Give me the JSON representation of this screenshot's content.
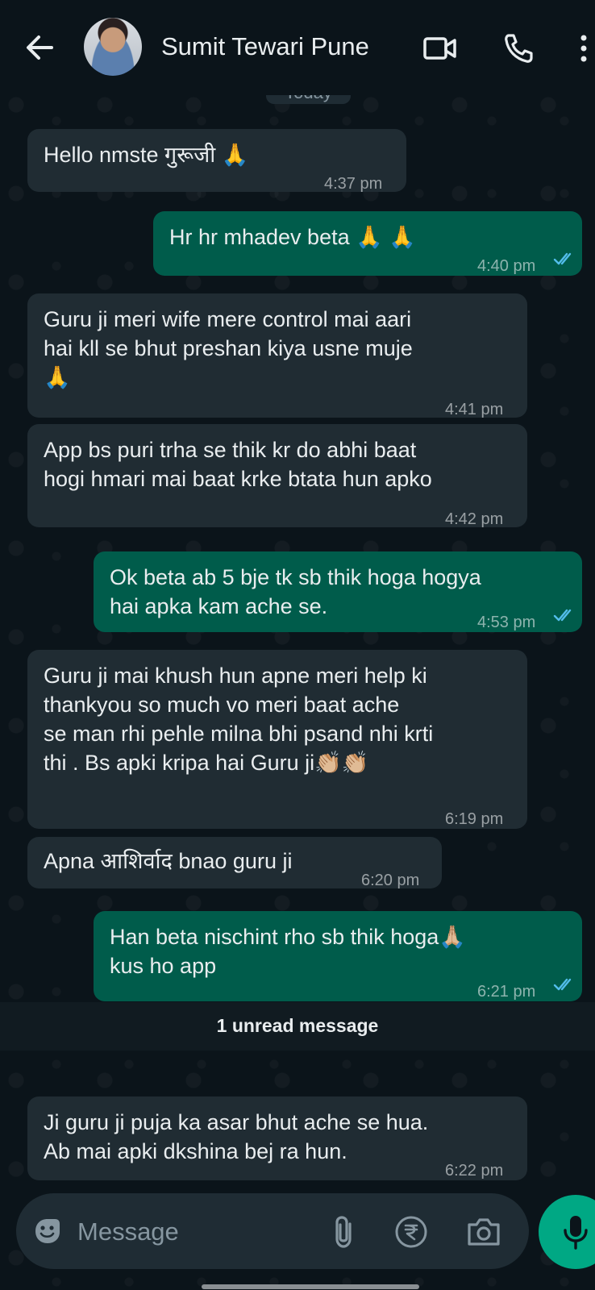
{
  "header": {
    "contact_name": "Sumit Tewari Pune",
    "icons": [
      "back-arrow-icon",
      "video-call-icon",
      "phone-call-icon",
      "more-vert-icon"
    ]
  },
  "date_chip": "Today",
  "messages": [
    {
      "direction": "incoming",
      "text": "Hello nmste  गुरूजी 🙏",
      "time": "4:37 pm"
    },
    {
      "direction": "outgoing",
      "text": "Hr hr mhadev beta 🙏 🙏",
      "time": "4:40 pm",
      "status": "read"
    },
    {
      "direction": "incoming",
      "text": "Guru ji meri wife mere control  mai aari\nhai kll se bhut preshan kiya usne muje\n🙏",
      "time": "4:41 pm"
    },
    {
      "direction": "incoming",
      "text": "App bs puri trha se thik kr do abhi baat\nhogi hmari mai baat krke btata hun apko",
      "time": "4:42 pm"
    },
    {
      "direction": "outgoing",
      "text": "Ok beta ab 5 bje tk sb thik hoga hogya\nhai apka kam ache se.",
      "time": "4:53 pm",
      "status": "read"
    },
    {
      "direction": "incoming",
      "text": "Guru ji mai khush hun apne meri help ki\nthankyou  so much vo meri baat ache\nse man rhi pehle milna bhi psand nhi krti\nthi . Bs apki kripa hai Guru ji👏🏼👏🏼",
      "time": "6:19 pm"
    },
    {
      "direction": "incoming",
      "text": "Apna आशिर्वाद bnao guru ji",
      "time": "6:20 pm"
    },
    {
      "direction": "outgoing",
      "text": "Han beta nischint rho sb thik hoga🙏🏼\nkus ho app",
      "time": "6:21 pm",
      "status": "read"
    },
    {
      "direction": "incoming",
      "text": "Ji guru ji puja ka asar bhut ache se hua.\nAb mai apki dkshina bej ra hun.",
      "time": "6:22 pm"
    }
  ],
  "unread_banner": "1 unread message",
  "composer": {
    "placeholder": "Message",
    "icons": [
      "emoji-sticker-icon",
      "attach-icon",
      "rupee-payment-icon",
      "camera-icon",
      "mic-icon"
    ]
  },
  "colors": {
    "background": "#0b141a",
    "incoming_bubble": "#202c33",
    "outgoing_bubble": "#005c4b",
    "read_ticks": "#53bdeb",
    "accent": "#00a884"
  }
}
